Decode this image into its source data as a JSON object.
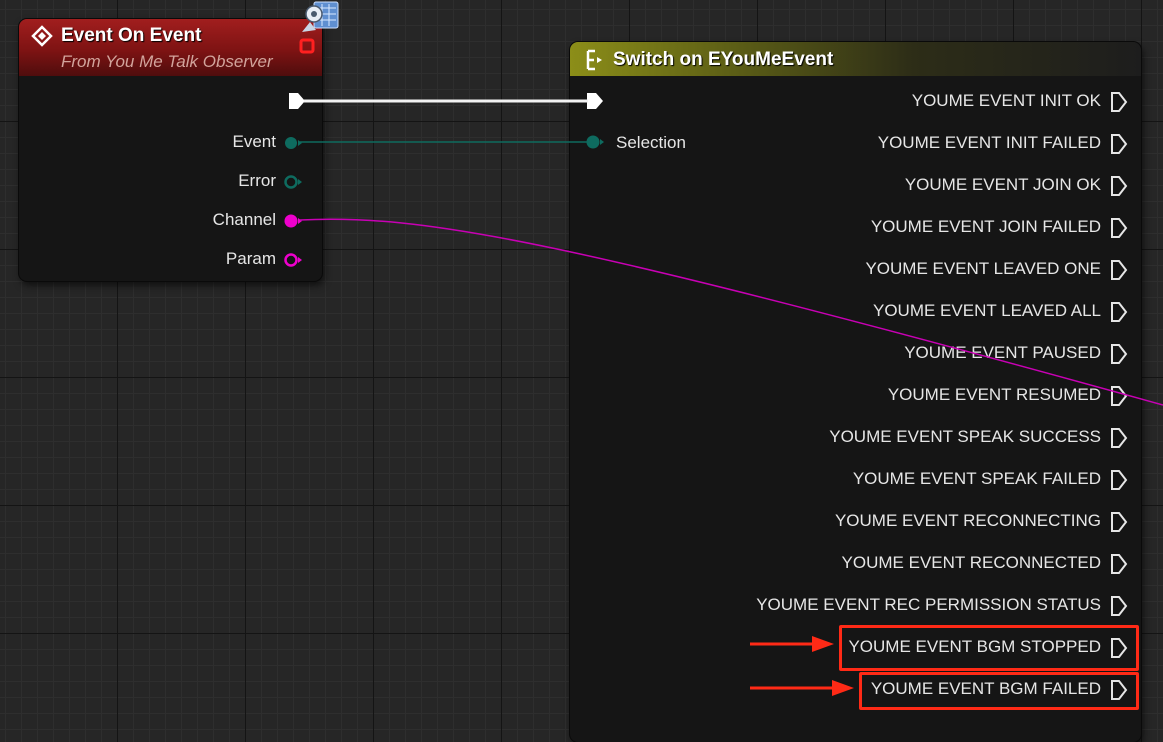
{
  "event_node": {
    "title": "Event On Event",
    "subtitle": "From You Me Talk Observer",
    "header_color": "#8e1a1a",
    "pins": [
      {
        "label": "Event",
        "type": "enum",
        "color": "#0e6b5f",
        "connected": true
      },
      {
        "label": "Error",
        "type": "enum",
        "color": "#0e6b5f",
        "connected": false
      },
      {
        "label": "Channel",
        "type": "string",
        "color": "#ee00cc",
        "connected": true
      },
      {
        "label": "Param",
        "type": "string",
        "color": "#ee00cc",
        "connected": false
      }
    ],
    "icons": [
      "event-diamond-icon",
      "delegate-pin-icon",
      "source-badge-icon"
    ]
  },
  "switch_node": {
    "title": "Switch on EYouMeEvent",
    "header_color": "#8c8e18",
    "input_pins": [
      {
        "label": "",
        "type": "exec"
      },
      {
        "label": "Selection",
        "type": "enum",
        "color": "#0e6b5f"
      }
    ],
    "outputs": [
      "YOUME EVENT INIT OK",
      "YOUME EVENT INIT FAILED",
      "YOUME EVENT JOIN OK",
      "YOUME EVENT JOIN FAILED",
      "YOUME EVENT LEAVED ONE",
      "YOUME EVENT LEAVED ALL",
      "YOUME EVENT PAUSED",
      "YOUME EVENT RESUMED",
      "YOUME EVENT SPEAK SUCCESS",
      "YOUME EVENT SPEAK FAILED",
      "YOUME EVENT RECONNECTING",
      "YOUME EVENT RECONNECTED",
      "YOUME EVENT REC PERMISSION STATUS",
      "YOUME EVENT BGM STOPPED",
      "YOUME EVENT BGM FAILED"
    ],
    "highlighted_outputs": [
      "YOUME EVENT BGM STOPPED",
      "YOUME EVENT BGM FAILED"
    ]
  },
  "annotation_color": "#ff2a16",
  "wire_colors": {
    "exec": "#ffffff",
    "enum": "#0e6b5f",
    "string": "#ee00cc"
  }
}
